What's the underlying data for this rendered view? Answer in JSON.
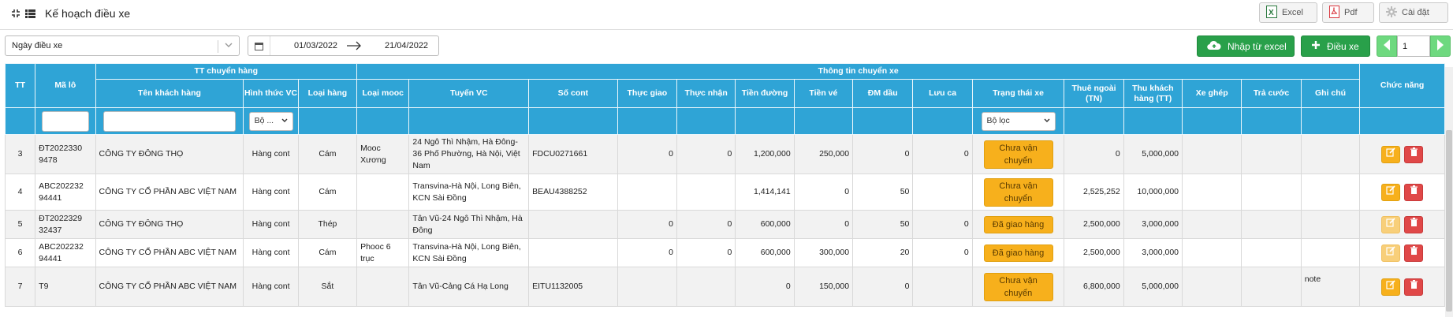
{
  "app": {
    "title": "Kế hoạch điều xe"
  },
  "top_actions": {
    "excel": "Excel",
    "pdf": "Pdf",
    "settings": "Cài đặt"
  },
  "filters": {
    "date_type": "Ngày điều xe",
    "date_from": "01/03/2022",
    "date_to": "21/04/2022"
  },
  "buttons": {
    "import_excel": "Nhập từ excel",
    "dispatch": "Điều xe"
  },
  "pager": {
    "page": "1"
  },
  "table": {
    "group_headers": {
      "tt": "TT",
      "ma_lo": "Mã lô",
      "tt_chuyen_hang": "TT chuyển hàng",
      "thong_tin_chuyen_xe": "Thông tin chuyển xe",
      "chuc_nang": "Chức năng"
    },
    "columns": [
      "Tên khách hàng",
      "Hình thức VC",
      "Loại hàng",
      "Loại mooc",
      "Tuyến VC",
      "Số cont",
      "Thực giao",
      "Thực nhận",
      "Tiền đường",
      "Tiền vé",
      "ĐM dầu",
      "Lưu ca",
      "Trạng thái xe",
      "Thuê ngoài (TN)",
      "Thu khách hàng (TT)",
      "Xe ghép",
      "Trả cước",
      "Ghi chú"
    ],
    "filter_select_short": "Bộ ...",
    "filter_select_status": "Bộ lọc",
    "rows": [
      {
        "tt": "3",
        "ma_lo": "ĐT2022330 9478",
        "khach_hang": "CÔNG TY ĐÔNG THỌ",
        "hinh_thuc": "Hàng cont",
        "loai_hang": "Cám",
        "loai_mooc": "Mooc Xương",
        "tuyen": "24 Ngô Thì Nhậm, Hà Đông-36 Phố Phường, Hà Nội, Việt Nam",
        "so_cont": "FDCU0271661",
        "thuc_giao": "0",
        "thuc_nhan": "0",
        "tien_duong": "1,200,000",
        "tien_ve": "250,000",
        "dm_dau": "0",
        "luu_ca": "0",
        "trang_thai": "Chưa vận chuyển",
        "thue_ngoai": "0",
        "thu_kh": "5,000,000",
        "xe_ghep": "",
        "tra_cuoc": "",
        "ghi_chu": ""
      },
      {
        "tt": "4",
        "ma_lo": "ABC202232 94441",
        "khach_hang": "CÔNG TY CỔ PHẦN ABC VIỆT NAM",
        "hinh_thuc": "Hàng cont",
        "loai_hang": "Cám",
        "loai_mooc": "",
        "tuyen": "Transvina-Hà Nội, Long Biên, KCN Sài Đồng",
        "so_cont": "BEAU4388252",
        "thuc_giao": "",
        "thuc_nhan": "",
        "tien_duong": "1,414,141",
        "tien_ve": "0",
        "dm_dau": "50",
        "luu_ca": "",
        "trang_thai": "Chưa vận chuyển",
        "thue_ngoai": "2,525,252",
        "thu_kh": "10,000,000",
        "xe_ghep": "",
        "tra_cuoc": "",
        "ghi_chu": ""
      },
      {
        "tt": "5",
        "ma_lo": "ĐT2022329 32437",
        "khach_hang": "CÔNG TY ĐÔNG THỌ",
        "hinh_thuc": "Hàng cont",
        "loai_hang": "Thép",
        "loai_mooc": "",
        "tuyen": "Tân Vũ-24 Ngô Thì Nhậm, Hà Đông",
        "so_cont": "",
        "thuc_giao": "0",
        "thuc_nhan": "0",
        "tien_duong": "600,000",
        "tien_ve": "0",
        "dm_dau": "50",
        "luu_ca": "0",
        "trang_thai": "Đã giao hàng",
        "thue_ngoai": "2,500,000",
        "thu_kh": "3,000,000",
        "xe_ghep": "",
        "tra_cuoc": "",
        "ghi_chu": ""
      },
      {
        "tt": "6",
        "ma_lo": "ABC202232 94441",
        "khach_hang": "CÔNG TY CỔ PHẦN ABC VIỆT NAM",
        "hinh_thuc": "Hàng cont",
        "loai_hang": "Cám",
        "loai_mooc": "Phooc 6 trục",
        "tuyen": "Transvina-Hà Nội, Long Biên, KCN Sài Đồng",
        "so_cont": "",
        "thuc_giao": "0",
        "thuc_nhan": "0",
        "tien_duong": "600,000",
        "tien_ve": "300,000",
        "dm_dau": "20",
        "luu_ca": "0",
        "trang_thai": "Đã giao hàng",
        "thue_ngoai": "2,500,000",
        "thu_kh": "3,000,000",
        "xe_ghep": "",
        "tra_cuoc": "",
        "ghi_chu": ""
      },
      {
        "tt": "7",
        "ma_lo": "T9",
        "khach_hang": "CÔNG TY CỔ PHẦN ABC VIỆT NAM",
        "hinh_thuc": "Hàng cont",
        "loai_hang": "Sắt",
        "loai_mooc": "",
        "tuyen": "Tân Vũ-Cảng Cá Hạ Long",
        "so_cont": "EITU1132005",
        "thuc_giao": "",
        "thuc_nhan": "",
        "tien_duong": "0",
        "tien_ve": "150,000",
        "dm_dau": "0",
        "luu_ca": "",
        "trang_thai": "Chưa vận chuyển",
        "thue_ngoai": "6,800,000",
        "thu_kh": "5,000,000",
        "xe_ghep": "",
        "tra_cuoc": "",
        "ghi_chu": "note"
      }
    ]
  },
  "colors": {
    "header_blue": "#2fa4d6",
    "green": "#29a04a",
    "status_yellow": "#f7b01c",
    "delete_red": "#e04848"
  },
  "icons": [
    "collapse-icon",
    "menu-icon",
    "excel-icon",
    "pdf-icon",
    "gear-icon",
    "chevron-down-icon",
    "calendar-icon",
    "arrow-right-icon",
    "cloud-upload-icon",
    "plus-icon",
    "prev-icon",
    "next-icon",
    "edit-icon",
    "trash-icon"
  ]
}
